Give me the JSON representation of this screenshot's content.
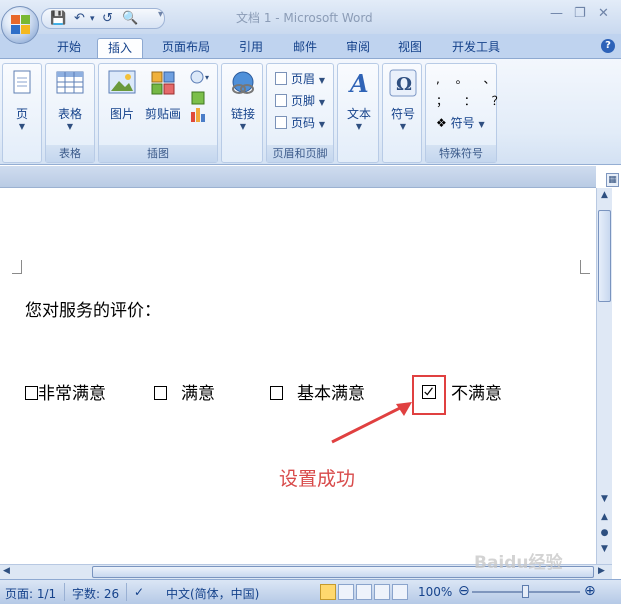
{
  "window": {
    "title": "文档 1 - Microsoft Word"
  },
  "tabs": [
    {
      "label": "开始"
    },
    {
      "label": "插入",
      "active": true
    },
    {
      "label": "页面布局"
    },
    {
      "label": "引用"
    },
    {
      "label": "邮件"
    },
    {
      "label": "审阅"
    },
    {
      "label": "视图"
    },
    {
      "label": "开发工具"
    }
  ],
  "ribbon": {
    "pages": {
      "label": "页"
    },
    "tables": {
      "button": "表格",
      "group": "表格"
    },
    "illustrations": {
      "picture": "图片",
      "clipart": "剪贴画",
      "group": "插图"
    },
    "links": {
      "button": "链接"
    },
    "header_footer": {
      "header": "页眉",
      "footer": "页脚",
      "page_number": "页码",
      "group": "页眉和页脚"
    },
    "text": {
      "button": "文本"
    },
    "symbols": {
      "button": "符号"
    },
    "special_symbols": {
      "row1": ", 。 、",
      "row2": "； ： ？",
      "symbol": "符号",
      "group": "特殊符号"
    }
  },
  "document": {
    "question": "您对服务的评价：",
    "options": [
      {
        "label": "非常满意",
        "checked": false
      },
      {
        "label": "满意",
        "checked": false
      },
      {
        "label": "基本满意",
        "checked": false
      },
      {
        "label": "不满意",
        "checked": true
      }
    ],
    "annotation": "设置成功",
    "accent_color": "#e04040"
  },
  "status": {
    "page": "页面: 1/1",
    "words": "字数: 26",
    "language": "中文(简体，中国)",
    "zoom": "100%"
  },
  "watermark": "Baidu经验"
}
